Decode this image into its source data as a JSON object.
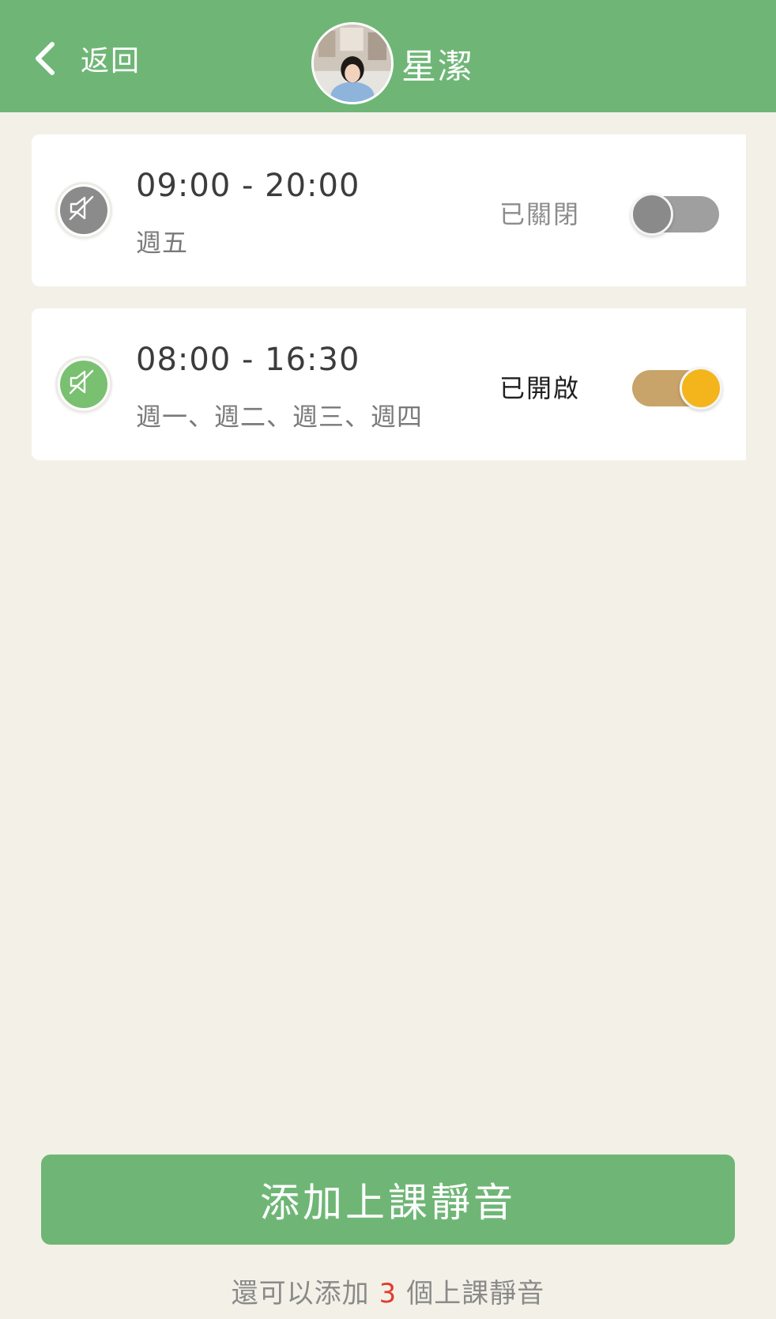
{
  "header": {
    "back_label": "返回",
    "profile_name": "星潔"
  },
  "schedules": [
    {
      "time": "09:00 - 20:00",
      "days": "週五",
      "status": "已關閉",
      "enabled": false
    },
    {
      "time": "08:00 - 16:30",
      "days": "週一、週二、週三、週四",
      "status": "已開啟",
      "enabled": true
    }
  ],
  "footer": {
    "add_button_label": "添加上課靜音",
    "remaining_prefix": "還可以添加",
    "remaining_count": "3",
    "remaining_suffix": "個上課靜音"
  },
  "colors": {
    "header_bg": "#6fb676",
    "page_bg": "#f3f1e7",
    "toggle_on_track": "#c8a46a",
    "toggle_on_knob": "#f4b51c",
    "toggle_off": "#9f9f9f",
    "count_highlight": "#e23b2f"
  },
  "icons": {
    "back": "chevron-left-icon",
    "mute": "speaker-muted-icon"
  }
}
